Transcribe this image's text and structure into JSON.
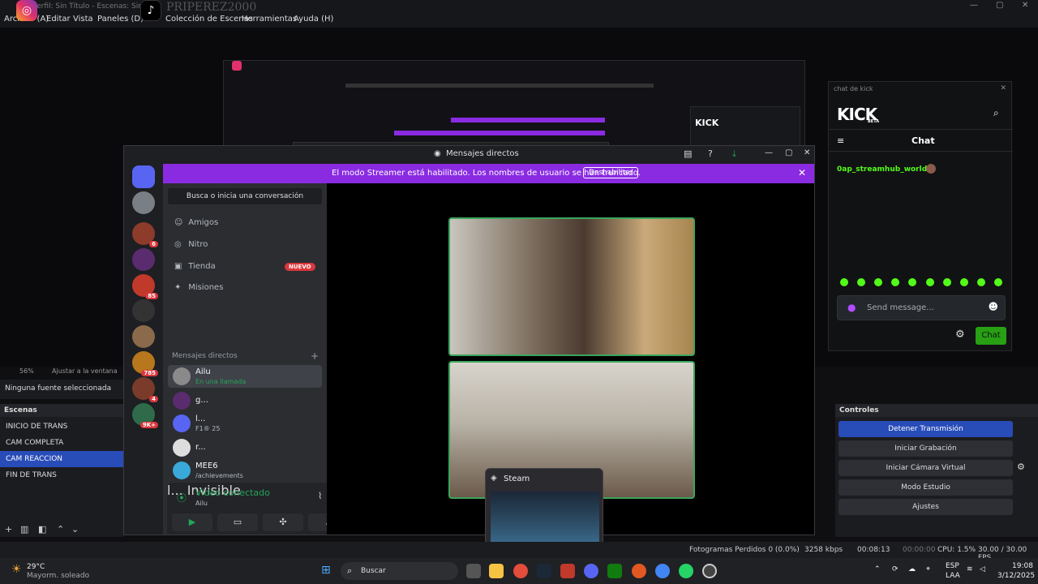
{
  "obs": {
    "window_title": "Perfil: Sin Título - Escenas: Sin T",
    "watermark": "PRIPEREZ2000",
    "menu": [
      "Archivo (A)",
      "Editar",
      "Vista",
      "Paneles (D)",
      "Colección de Escenas",
      "Herramientas",
      "Ayuda (H)"
    ],
    "zoom": "56%",
    "fit_label": "Ajustar a la ventana",
    "no_source": "Ninguna fuente seleccionada",
    "scenes_title": "Escenas",
    "scenes": [
      "INICIO DE TRANS",
      "CAM COMPLETA",
      "CAM REACCION",
      "FIN DE TRANS"
    ],
    "selected_scene": "CAM REACCION",
    "controls_title": "Controles",
    "controls": [
      "Detener Transmisión",
      "Iniciar Grabación",
      "Iniciar Cámara Virtual",
      "Modo Estudio",
      "Ajustes"
    ],
    "status": {
      "dropped": "Fotogramas Perdidos 0 (0.0%)",
      "kbps": "3258 kbps",
      "stream_time": "00:08:13",
      "rec_time": "00:00:00",
      "cpu": "CPU: 1.5%",
      "fps": "30.00 / 30.00 FPS"
    }
  },
  "discord": {
    "title": "Mensajes directos",
    "banner": "El modo Streamer está habilitado. Los nombres de usuario se han truncado.",
    "banner_button": "Deshabilitar",
    "search": "Busca o inicia una conversación",
    "nav": [
      {
        "label": "Amigos",
        "icon": "friends-icon"
      },
      {
        "label": "Nitro",
        "icon": "nitro-icon"
      },
      {
        "label": "Tienda",
        "icon": "shop-icon"
      },
      {
        "label": "Misiones",
        "icon": "quests-icon"
      }
    ],
    "new_badge": "NUEVO",
    "dm_section": "Mensajes directos",
    "server_badges": [
      "6",
      "85",
      "785",
      "4",
      "9K+"
    ],
    "dms": [
      {
        "name": "Ailu",
        "sub": "En una llamada"
      },
      {
        "name": "g...",
        "sub": ""
      },
      {
        "name": "l...",
        "sub": "F1® 25"
      },
      {
        "name": "r...",
        "sub": ""
      },
      {
        "name": "MEE6",
        "sub": "/achievements"
      }
    ],
    "voice_title": "Vídeo conectado",
    "voice_sub": "Ailu",
    "user_name": "l...",
    "user_status": "Invisible"
  },
  "steam_popup": {
    "title": "Steam"
  },
  "kick": {
    "dock_title": "chat de kick",
    "logo": "KICK",
    "beta": "BETA",
    "chat_label": "Chat",
    "user": "0ap_streamhub_world:",
    "placeholder": "Send message...",
    "send": "Chat"
  },
  "taskbar": {
    "weather_temp": "29°C",
    "weather_desc": "Mayorm. soleado",
    "search": "Buscar",
    "lang1": "ESP",
    "lang2": "LAA",
    "time": "19:08",
    "date": "3/12/2025"
  }
}
